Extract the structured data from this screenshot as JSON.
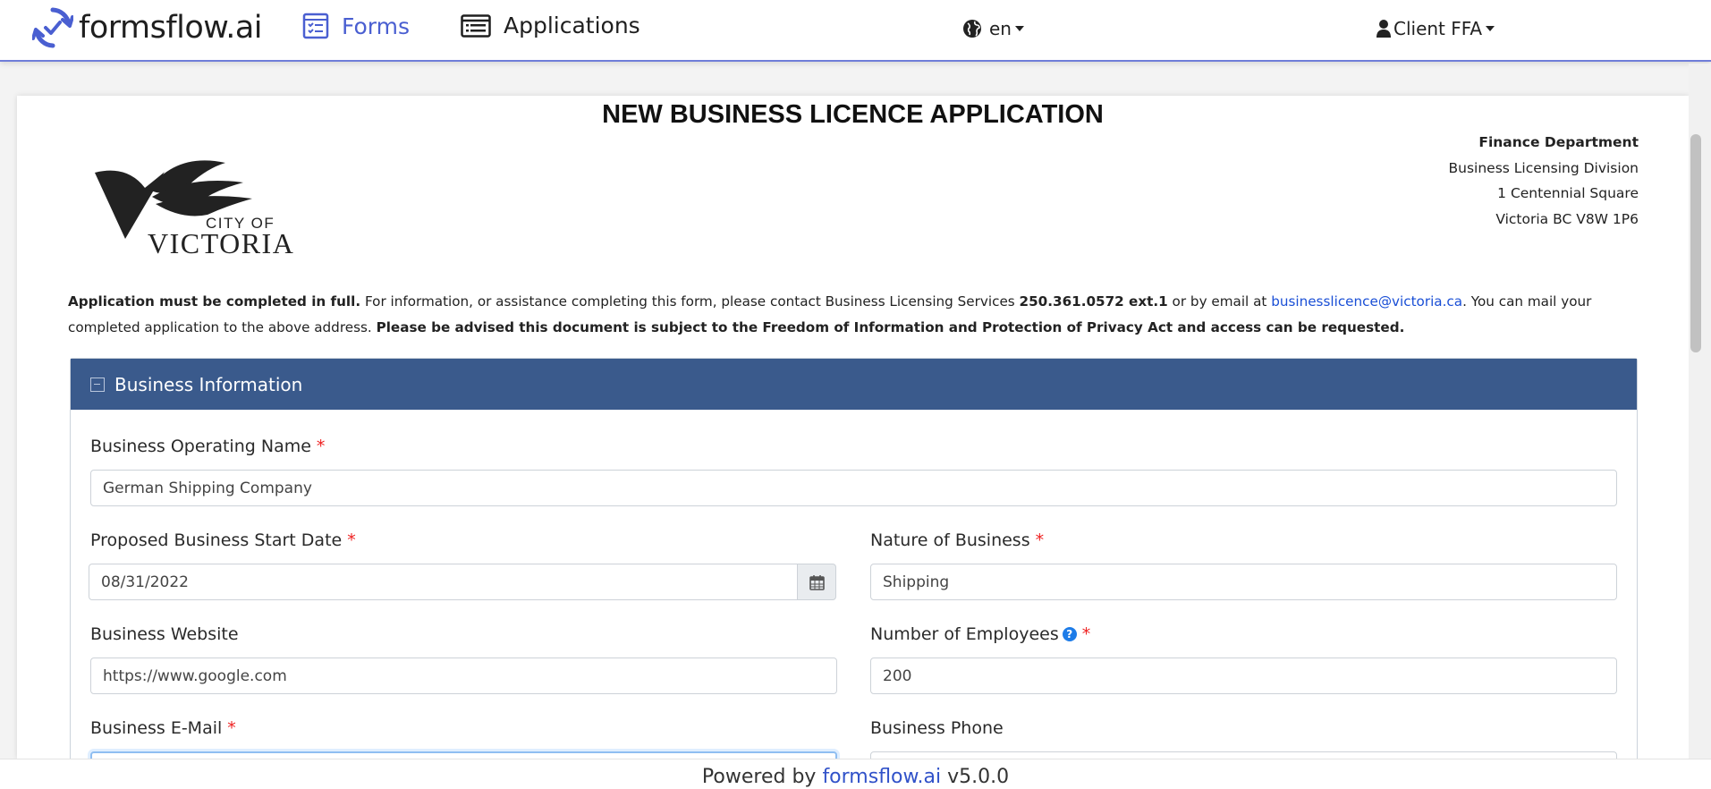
{
  "navbar": {
    "brand": "formsflow.ai",
    "nav": [
      {
        "label": "Forms",
        "active": true
      },
      {
        "label": "Applications",
        "active": false
      }
    ],
    "language": "en",
    "user": "Client FFA",
    "accent_color": "#4a5fd1"
  },
  "form": {
    "title": "NEW BUSINESS LICENCE APPLICATION",
    "logo": {
      "line1": "CITY OF",
      "line2": "VICTORIA"
    },
    "address": [
      "Finance Department",
      "Business Licensing Division",
      "1 Centennial Square",
      "Victoria BC V8W 1P6"
    ],
    "intro": {
      "lead_bold": "Application must be completed in full.",
      "text1": " For information, or assistance completing this form, please contact Business Licensing Services ",
      "phone_bold": "250.361.0572 ext.1",
      "text2": " or by email at ",
      "email": "businesslicence@victoria.ca",
      "text3": ". You can mail your completed application to the above address. ",
      "notice_bold": "Please be advised this document is subject to the Freedom of Information and Protection of Privacy Act and access can be requested."
    },
    "panel": {
      "title": "Business Information",
      "header_color": "#3a5a8c",
      "fields": {
        "operating_name": {
          "label": "Business Operating Name",
          "required": "*",
          "value": "German Shipping Company"
        },
        "start_date": {
          "label": "Proposed Business Start Date",
          "required": "*",
          "value": "08/31/2022"
        },
        "nature": {
          "label": "Nature of Business",
          "required": "*",
          "value": "Shipping"
        },
        "website": {
          "label": "Business Website",
          "value": "https://www.google.com"
        },
        "employees": {
          "label": "Number of Employees",
          "help": "?",
          "required": "*",
          "value": "200"
        },
        "email": {
          "label": "Business E-Mail",
          "required": "*",
          "value": ""
        },
        "phone": {
          "label": "Business Phone",
          "value": ""
        }
      }
    }
  },
  "footer": {
    "prefix": "Powered by ",
    "link": "formsflow.ai",
    "version": " v5.0.0"
  }
}
